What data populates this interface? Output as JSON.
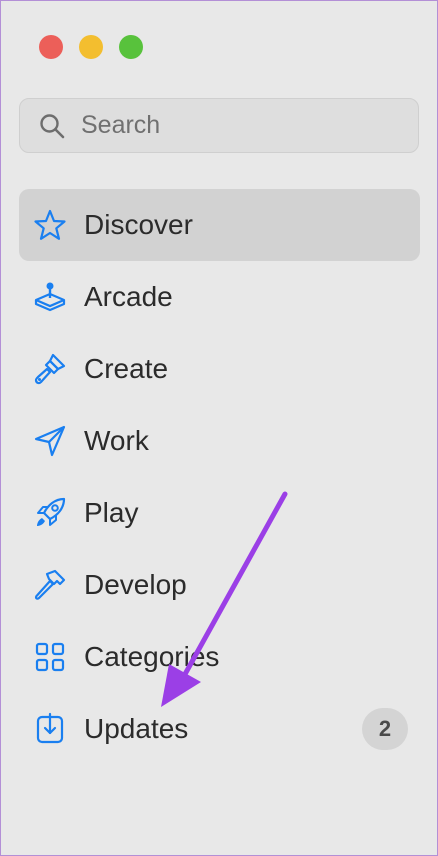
{
  "window": {
    "controls": [
      "close",
      "minimize",
      "maximize"
    ]
  },
  "search": {
    "placeholder": "Search",
    "icon": "search-icon"
  },
  "nav": {
    "items": [
      {
        "label": "Discover",
        "icon": "star-icon",
        "active": true
      },
      {
        "label": "Arcade",
        "icon": "joystick-icon"
      },
      {
        "label": "Create",
        "icon": "paintbrush-icon"
      },
      {
        "label": "Work",
        "icon": "paperplane-icon"
      },
      {
        "label": "Play",
        "icon": "rocket-icon"
      },
      {
        "label": "Develop",
        "icon": "hammer-icon"
      },
      {
        "label": "Categories",
        "icon": "grid-icon"
      },
      {
        "label": "Updates",
        "icon": "download-icon",
        "badge": "2"
      }
    ]
  },
  "colors": {
    "accent": "#1a7ff0",
    "annotation_arrow": "#9b3fe6"
  }
}
